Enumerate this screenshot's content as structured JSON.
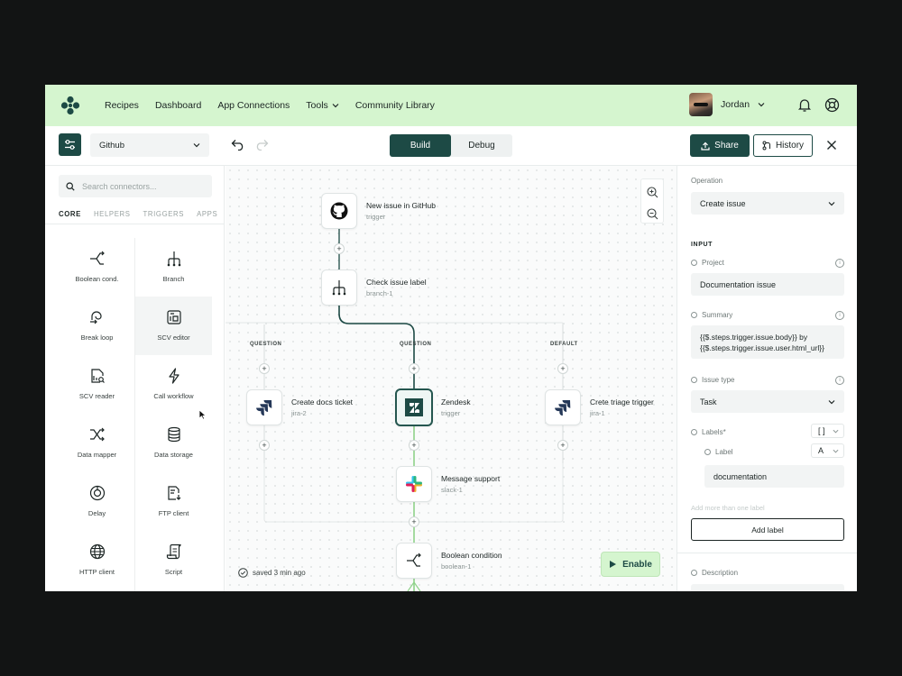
{
  "nav": {
    "links": [
      "Recipes",
      "Dashboard",
      "App Connections",
      "Tools",
      "Community Library"
    ],
    "user_name": "Jordan"
  },
  "toolbar": {
    "connector_select": "Github",
    "tab_build": "Build",
    "tab_debug": "Debug",
    "active_tab": "Build",
    "share_label": "Share",
    "history_label": "History"
  },
  "sidebar": {
    "search_placeholder": "Search connectors...",
    "tabs": [
      "CORE",
      "HELPERS",
      "TRIGGERS",
      "APPS"
    ],
    "active_tab": "CORE",
    "connectors": [
      {
        "label": "Boolean cond.",
        "icon": "boolean-icon"
      },
      {
        "label": "Branch",
        "icon": "branch-icon"
      },
      {
        "label": "Break loop",
        "icon": "break-loop-icon"
      },
      {
        "label": "SCV editor",
        "icon": "editor-icon"
      },
      {
        "label": "SCV reader",
        "icon": "reader-icon"
      },
      {
        "label": "Call workflow",
        "icon": "lightning-icon"
      },
      {
        "label": "Data mapper",
        "icon": "shuffle-icon"
      },
      {
        "label": "Data storage",
        "icon": "database-icon"
      },
      {
        "label": "Delay",
        "icon": "clock-icon"
      },
      {
        "label": "FTP client",
        "icon": "file-download-icon"
      },
      {
        "label": "HTTP client",
        "icon": "globe-icon"
      },
      {
        "label": "Script",
        "icon": "script-icon"
      }
    ]
  },
  "canvas": {
    "nodes": [
      {
        "title": "New issue in GitHub",
        "sub": "trigger",
        "icon": "github-icon"
      },
      {
        "title": "Check issue label",
        "sub": "branch-1",
        "icon": "branch-icon"
      },
      {
        "title": "Create docs ticket",
        "sub": "jira-2",
        "icon": "jira-icon"
      },
      {
        "title": "Zendesk",
        "sub": "trigger",
        "icon": "zendesk-icon"
      },
      {
        "title": "Crete triage trigger",
        "sub": "jira-1",
        "icon": "jira-icon"
      },
      {
        "title": "Message support",
        "sub": "slack-1",
        "icon": "slack-icon"
      },
      {
        "title": "Boolean condition",
        "sub": "boolean-1",
        "icon": "boolean-icon"
      }
    ],
    "branch_labels": [
      "QUESTION",
      "QUESTION",
      "DEFAULT"
    ],
    "saved_text": "saved 3 min ago",
    "enable_label": "Enable"
  },
  "panel": {
    "operation_label": "Operation",
    "operation_value": "Create issue",
    "input_heading": "INPUT",
    "project_label": "Project",
    "project_value": "Documentation issue",
    "summary_label": "Summary",
    "summary_line1": "{{$.steps.trigger.issue.body}} by",
    "summary_line2": "{{$.steps.trigger.issue.user.html_url}}",
    "issue_type_label": "Issue type",
    "issue_type_value": "Task",
    "labels_label": "Labels*",
    "labels_type": "[ ]",
    "label_label": "Label",
    "label_type": "A",
    "label_value": "documentation",
    "hint": "Add more than one label",
    "add_label": "Add label",
    "description_label": "Description"
  },
  "colors": {
    "accent": "#1d4a45",
    "nav_bg": "#d5f5cf",
    "edge_green": "#8fd28a"
  }
}
